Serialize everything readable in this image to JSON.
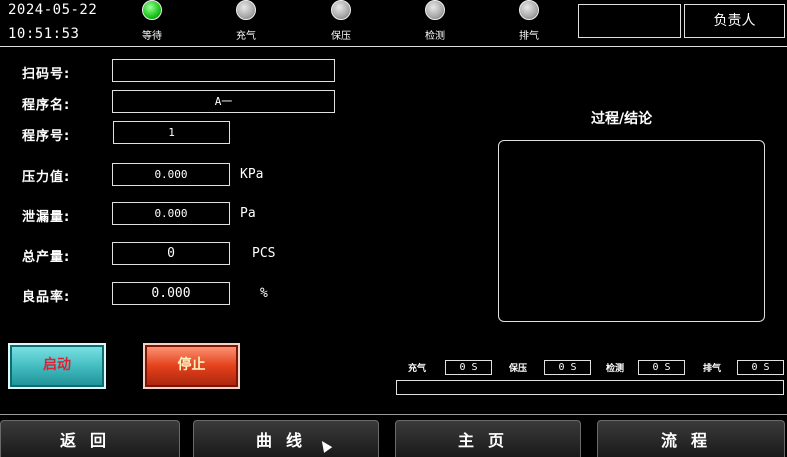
{
  "header": {
    "date": "2024-05-22",
    "time": "10:51:53",
    "stages": [
      {
        "label": "等待",
        "state": "on"
      },
      {
        "label": "充气",
        "state": "off"
      },
      {
        "label": "保压",
        "state": "off"
      },
      {
        "label": "检测",
        "state": "off"
      },
      {
        "label": "排气",
        "state": "off"
      }
    ],
    "responsible_label": "负责人",
    "operator_value": ""
  },
  "form": {
    "scan_code": {
      "label": "扫码号:",
      "value": ""
    },
    "program_name": {
      "label": "程序名:",
      "value": "A一"
    },
    "program_no": {
      "label": "程序号:",
      "value": "1"
    },
    "pressure": {
      "label": "压力值:",
      "value": "0.000",
      "unit": "KPa"
    },
    "leak": {
      "label": "泄漏量:",
      "value": "0.000",
      "unit": "Pa"
    },
    "total_output": {
      "label": "总产量:",
      "value": "0",
      "unit": "PCS"
    },
    "yield_rate": {
      "label": "良品率:",
      "value": "0.000",
      "unit": "%"
    }
  },
  "process": {
    "title": "过程/结论",
    "content": ""
  },
  "buttons": {
    "start": "启动",
    "stop": "停止"
  },
  "timers": [
    {
      "label": "充气",
      "value": "0 S"
    },
    {
      "label": "保压",
      "value": "0 S"
    },
    {
      "label": "检测",
      "value": "0 S"
    },
    {
      "label": "排气",
      "value": "0 S"
    }
  ],
  "progress": {
    "fraction": 0
  },
  "nav": {
    "back": "返回",
    "curve": "曲线",
    "home": "主页",
    "flow": "流程"
  },
  "colors": {
    "led_on": "#19c419",
    "led_off": "#a8a8a8",
    "start_bg": "#3fb9bd",
    "stop_bg": "#e4411c"
  }
}
